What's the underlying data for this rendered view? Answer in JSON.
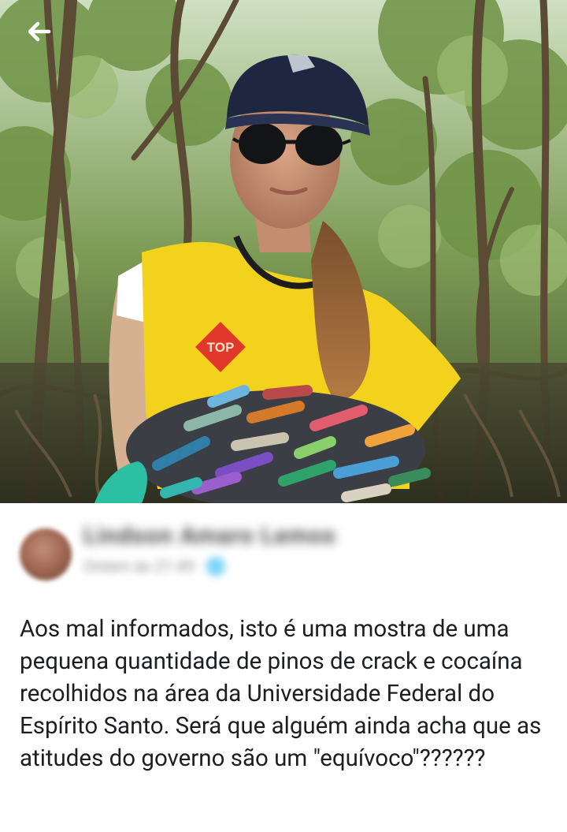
{
  "photo": {
    "badge_text": "TOP"
  },
  "header": {
    "back_icon": "arrow-left-icon"
  },
  "post": {
    "author_name": "Lindson Amaro Lemos",
    "meta": "Ontem às 21:49 · 🌐",
    "text": "Aos mal informados, isto é uma mostra de uma pequena quantidade de pinos de crack e cocaína recolhidos na área da Universidade Federal do Espírito Santo.  Será que alguém ainda acha que as atitudes do governo são um \"equívoco\"??????"
  },
  "colors": {
    "vest": "#f3d21d",
    "badge": "#e0392b",
    "cap": "#1f2740",
    "foliage": "#5d7a3e"
  }
}
